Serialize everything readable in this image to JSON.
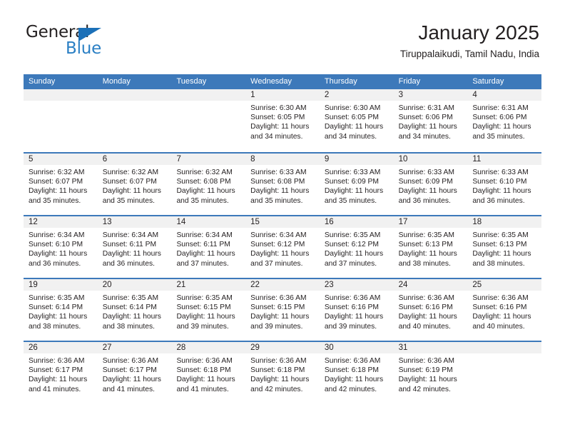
{
  "brand": {
    "name_top": "General",
    "name_bottom": "Blue",
    "accent_color": "#2a7fc4",
    "triangle_color": "#1b70b8"
  },
  "header": {
    "title": "January 2025",
    "subtitle": "Tiruppalaikudi, Tamil Nadu, India"
  },
  "theme": {
    "header_blue": "#3d79ba",
    "daynum_band": "#f1f1f1",
    "text": "#231f20"
  },
  "weekdays": [
    "Sunday",
    "Monday",
    "Tuesday",
    "Wednesday",
    "Thursday",
    "Friday",
    "Saturday"
  ],
  "weeks": [
    [
      {
        "day": "",
        "sunrise": "",
        "sunset": "",
        "daylight_1": "",
        "daylight_2": ""
      },
      {
        "day": "",
        "sunrise": "",
        "sunset": "",
        "daylight_1": "",
        "daylight_2": ""
      },
      {
        "day": "",
        "sunrise": "",
        "sunset": "",
        "daylight_1": "",
        "daylight_2": ""
      },
      {
        "day": "1",
        "sunrise": "Sunrise: 6:30 AM",
        "sunset": "Sunset: 6:05 PM",
        "daylight_1": "Daylight: 11 hours",
        "daylight_2": "and 34 minutes."
      },
      {
        "day": "2",
        "sunrise": "Sunrise: 6:30 AM",
        "sunset": "Sunset: 6:05 PM",
        "daylight_1": "Daylight: 11 hours",
        "daylight_2": "and 34 minutes."
      },
      {
        "day": "3",
        "sunrise": "Sunrise: 6:31 AM",
        "sunset": "Sunset: 6:06 PM",
        "daylight_1": "Daylight: 11 hours",
        "daylight_2": "and 34 minutes."
      },
      {
        "day": "4",
        "sunrise": "Sunrise: 6:31 AM",
        "sunset": "Sunset: 6:06 PM",
        "daylight_1": "Daylight: 11 hours",
        "daylight_2": "and 35 minutes."
      }
    ],
    [
      {
        "day": "5",
        "sunrise": "Sunrise: 6:32 AM",
        "sunset": "Sunset: 6:07 PM",
        "daylight_1": "Daylight: 11 hours",
        "daylight_2": "and 35 minutes."
      },
      {
        "day": "6",
        "sunrise": "Sunrise: 6:32 AM",
        "sunset": "Sunset: 6:07 PM",
        "daylight_1": "Daylight: 11 hours",
        "daylight_2": "and 35 minutes."
      },
      {
        "day": "7",
        "sunrise": "Sunrise: 6:32 AM",
        "sunset": "Sunset: 6:08 PM",
        "daylight_1": "Daylight: 11 hours",
        "daylight_2": "and 35 minutes."
      },
      {
        "day": "8",
        "sunrise": "Sunrise: 6:33 AM",
        "sunset": "Sunset: 6:08 PM",
        "daylight_1": "Daylight: 11 hours",
        "daylight_2": "and 35 minutes."
      },
      {
        "day": "9",
        "sunrise": "Sunrise: 6:33 AM",
        "sunset": "Sunset: 6:09 PM",
        "daylight_1": "Daylight: 11 hours",
        "daylight_2": "and 35 minutes."
      },
      {
        "day": "10",
        "sunrise": "Sunrise: 6:33 AM",
        "sunset": "Sunset: 6:09 PM",
        "daylight_1": "Daylight: 11 hours",
        "daylight_2": "and 36 minutes."
      },
      {
        "day": "11",
        "sunrise": "Sunrise: 6:33 AM",
        "sunset": "Sunset: 6:10 PM",
        "daylight_1": "Daylight: 11 hours",
        "daylight_2": "and 36 minutes."
      }
    ],
    [
      {
        "day": "12",
        "sunrise": "Sunrise: 6:34 AM",
        "sunset": "Sunset: 6:10 PM",
        "daylight_1": "Daylight: 11 hours",
        "daylight_2": "and 36 minutes."
      },
      {
        "day": "13",
        "sunrise": "Sunrise: 6:34 AM",
        "sunset": "Sunset: 6:11 PM",
        "daylight_1": "Daylight: 11 hours",
        "daylight_2": "and 36 minutes."
      },
      {
        "day": "14",
        "sunrise": "Sunrise: 6:34 AM",
        "sunset": "Sunset: 6:11 PM",
        "daylight_1": "Daylight: 11 hours",
        "daylight_2": "and 37 minutes."
      },
      {
        "day": "15",
        "sunrise": "Sunrise: 6:34 AM",
        "sunset": "Sunset: 6:12 PM",
        "daylight_1": "Daylight: 11 hours",
        "daylight_2": "and 37 minutes."
      },
      {
        "day": "16",
        "sunrise": "Sunrise: 6:35 AM",
        "sunset": "Sunset: 6:12 PM",
        "daylight_1": "Daylight: 11 hours",
        "daylight_2": "and 37 minutes."
      },
      {
        "day": "17",
        "sunrise": "Sunrise: 6:35 AM",
        "sunset": "Sunset: 6:13 PM",
        "daylight_1": "Daylight: 11 hours",
        "daylight_2": "and 38 minutes."
      },
      {
        "day": "18",
        "sunrise": "Sunrise: 6:35 AM",
        "sunset": "Sunset: 6:13 PM",
        "daylight_1": "Daylight: 11 hours",
        "daylight_2": "and 38 minutes."
      }
    ],
    [
      {
        "day": "19",
        "sunrise": "Sunrise: 6:35 AM",
        "sunset": "Sunset: 6:14 PM",
        "daylight_1": "Daylight: 11 hours",
        "daylight_2": "and 38 minutes."
      },
      {
        "day": "20",
        "sunrise": "Sunrise: 6:35 AM",
        "sunset": "Sunset: 6:14 PM",
        "daylight_1": "Daylight: 11 hours",
        "daylight_2": "and 38 minutes."
      },
      {
        "day": "21",
        "sunrise": "Sunrise: 6:35 AM",
        "sunset": "Sunset: 6:15 PM",
        "daylight_1": "Daylight: 11 hours",
        "daylight_2": "and 39 minutes."
      },
      {
        "day": "22",
        "sunrise": "Sunrise: 6:36 AM",
        "sunset": "Sunset: 6:15 PM",
        "daylight_1": "Daylight: 11 hours",
        "daylight_2": "and 39 minutes."
      },
      {
        "day": "23",
        "sunrise": "Sunrise: 6:36 AM",
        "sunset": "Sunset: 6:16 PM",
        "daylight_1": "Daylight: 11 hours",
        "daylight_2": "and 39 minutes."
      },
      {
        "day": "24",
        "sunrise": "Sunrise: 6:36 AM",
        "sunset": "Sunset: 6:16 PM",
        "daylight_1": "Daylight: 11 hours",
        "daylight_2": "and 40 minutes."
      },
      {
        "day": "25",
        "sunrise": "Sunrise: 6:36 AM",
        "sunset": "Sunset: 6:16 PM",
        "daylight_1": "Daylight: 11 hours",
        "daylight_2": "and 40 minutes."
      }
    ],
    [
      {
        "day": "26",
        "sunrise": "Sunrise: 6:36 AM",
        "sunset": "Sunset: 6:17 PM",
        "daylight_1": "Daylight: 11 hours",
        "daylight_2": "and 41 minutes."
      },
      {
        "day": "27",
        "sunrise": "Sunrise: 6:36 AM",
        "sunset": "Sunset: 6:17 PM",
        "daylight_1": "Daylight: 11 hours",
        "daylight_2": "and 41 minutes."
      },
      {
        "day": "28",
        "sunrise": "Sunrise: 6:36 AM",
        "sunset": "Sunset: 6:18 PM",
        "daylight_1": "Daylight: 11 hours",
        "daylight_2": "and 41 minutes."
      },
      {
        "day": "29",
        "sunrise": "Sunrise: 6:36 AM",
        "sunset": "Sunset: 6:18 PM",
        "daylight_1": "Daylight: 11 hours",
        "daylight_2": "and 42 minutes."
      },
      {
        "day": "30",
        "sunrise": "Sunrise: 6:36 AM",
        "sunset": "Sunset: 6:18 PM",
        "daylight_1": "Daylight: 11 hours",
        "daylight_2": "and 42 minutes."
      },
      {
        "day": "31",
        "sunrise": "Sunrise: 6:36 AM",
        "sunset": "Sunset: 6:19 PM",
        "daylight_1": "Daylight: 11 hours",
        "daylight_2": "and 42 minutes."
      },
      {
        "day": "",
        "sunrise": "",
        "sunset": "",
        "daylight_1": "",
        "daylight_2": ""
      }
    ]
  ]
}
